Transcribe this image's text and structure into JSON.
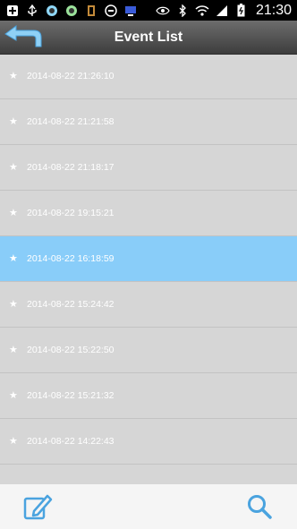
{
  "status_bar": {
    "time": "21:30",
    "left_icons": [
      "add-box-icon",
      "usb-icon",
      "app-icon-1",
      "app-icon-2",
      "app-icon-3",
      "block-icon",
      "monitor-icon"
    ],
    "right_icons": [
      "eye-icon",
      "bluetooth-icon",
      "wifi-icon",
      "signal-icon",
      "battery-icon"
    ]
  },
  "header": {
    "title": "Event List"
  },
  "events": [
    {
      "label": "2014-08-22 21:26:10",
      "selected": false
    },
    {
      "label": "2014-08-22 21:21:58",
      "selected": false
    },
    {
      "label": "2014-08-22 21:18:17",
      "selected": false
    },
    {
      "label": "2014-08-22 19:15:21",
      "selected": false
    },
    {
      "label": "2014-08-22 16:18:59",
      "selected": true
    },
    {
      "label": "2014-08-22 15:24:42",
      "selected": false
    },
    {
      "label": "2014-08-22 15:22:50",
      "selected": false
    },
    {
      "label": "2014-08-22 15:21:32",
      "selected": false
    },
    {
      "label": "2014-08-22 14:22:43",
      "selected": false
    }
  ],
  "colors": {
    "accent": "#4aa3df",
    "selected_row": "#89cdf9",
    "list_bg": "#d6d6d6"
  },
  "toolbar": {
    "left_icon": "edit-icon",
    "right_icon": "search-icon"
  }
}
